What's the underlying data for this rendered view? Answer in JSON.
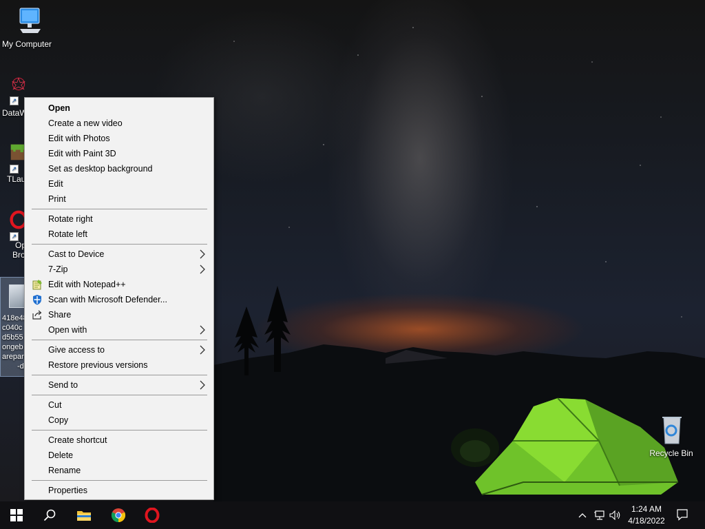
{
  "desktop_icons": {
    "my_computer": "My Computer",
    "datawrangler": "DataW",
    "tlauncher": "TLau",
    "opera_line1": "Op",
    "opera_line2": "Bro",
    "recycle_bin": "Recycle Bin"
  },
  "selected_file": {
    "name_lines": [
      "418e48",
      "c040c",
      "d5b55",
      "ongeb",
      "arepar",
      "-d"
    ]
  },
  "context_menu": {
    "items": [
      {
        "label": "Open",
        "bold": true
      },
      {
        "label": "Create a new video"
      },
      {
        "label": "Edit with Photos"
      },
      {
        "label": "Edit with Paint 3D"
      },
      {
        "label": "Set as desktop background"
      },
      {
        "label": "Edit"
      },
      {
        "label": "Print"
      },
      {
        "label": "Rotate right"
      },
      {
        "label": "Rotate left"
      },
      {
        "label": "Cast to Device",
        "submenu": true
      },
      {
        "label": "7-Zip",
        "submenu": true
      },
      {
        "label": "Edit with Notepad++",
        "icon": "notepad-plus-plus-icon"
      },
      {
        "label": "Scan with Microsoft Defender...",
        "icon": "defender-shield-icon"
      },
      {
        "label": "Share",
        "icon": "share-icon"
      },
      {
        "label": "Open with",
        "submenu": true
      },
      {
        "label": "Give access to",
        "submenu": true
      },
      {
        "label": "Restore previous versions"
      },
      {
        "label": "Send to",
        "submenu": true
      },
      {
        "label": "Cut"
      },
      {
        "label": "Copy"
      },
      {
        "label": "Create shortcut"
      },
      {
        "label": "Delete"
      },
      {
        "label": "Rename"
      },
      {
        "label": "Properties"
      }
    ]
  },
  "taskbar": {
    "apps": [
      "start-icon",
      "search-icon",
      "file-explorer-icon",
      "chrome-icon",
      "opera-icon"
    ],
    "tray_icons": [
      "chevron-up-icon",
      "network-icon",
      "volume-icon"
    ],
    "time": "1:24 AM",
    "date": "4/18/2022",
    "notification_icon": "notification-icon"
  },
  "colors": {
    "menu_bg": "#f2f2f2",
    "taskbar_bg": "#101013",
    "tent_green": "#7bd42a",
    "horizon_glow": "#ff6e1e"
  }
}
